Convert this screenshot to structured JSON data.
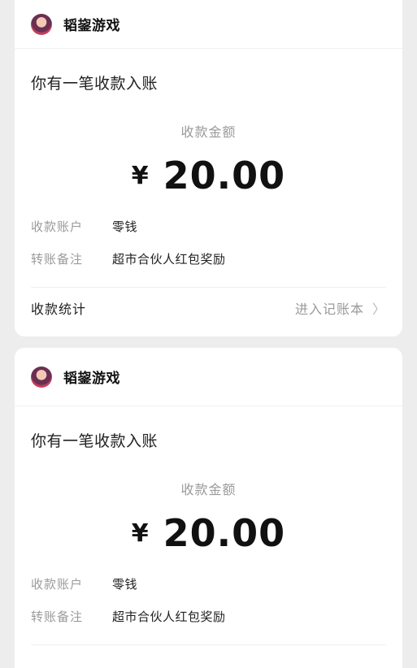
{
  "cards": [
    {
      "app_name": "韬鋆游戏",
      "headline": "你有一笔收款入账",
      "amount_label": "收款金额",
      "currency": "¥",
      "amount": "20.00",
      "fields": [
        {
          "key": "收款账户",
          "value": "零钱"
        },
        {
          "key": "转账备注",
          "value": "超市合伙人红包奖励"
        }
      ],
      "footer_left": "收款统计",
      "footer_right": "进入记账本"
    },
    {
      "app_name": "韬鋆游戏",
      "headline": "你有一笔收款入账",
      "amount_label": "收款金额",
      "currency": "¥",
      "amount": "20.00",
      "fields": [
        {
          "key": "收款账户",
          "value": "零钱"
        },
        {
          "key": "转账备注",
          "value": "超市合伙人红包奖励"
        }
      ]
    }
  ],
  "icons": {
    "avatar": "avatar-icon",
    "chevron": "chevron-right-icon"
  }
}
